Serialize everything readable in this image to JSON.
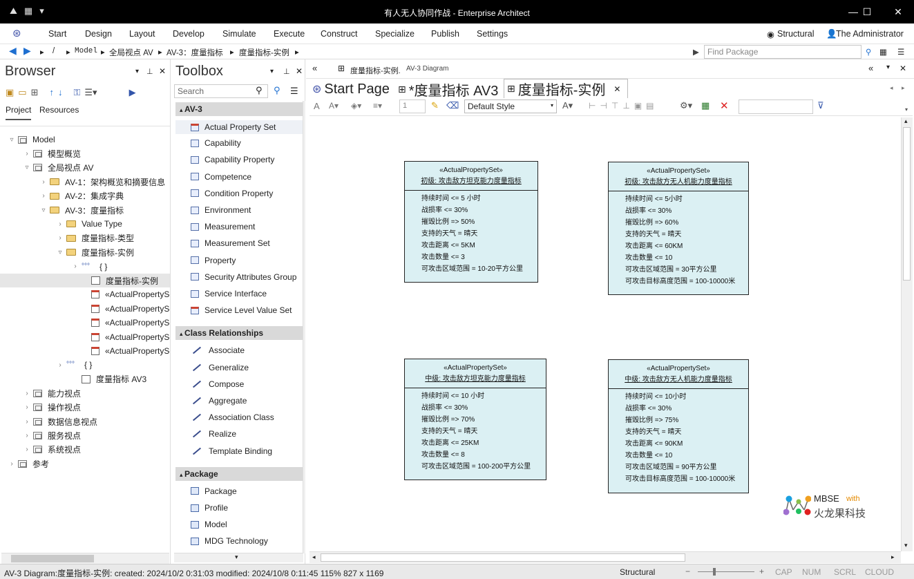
{
  "window": {
    "title": "有人无人协同作战 - Enterprise Architect"
  },
  "ribbon": {
    "menu": [
      "Start",
      "Design",
      "Layout",
      "Develop",
      "Simulate",
      "Execute",
      "Construct",
      "Specialize",
      "Publish",
      "Settings"
    ],
    "perspective": "Structural",
    "user": "The Administrator"
  },
  "nav": {
    "crumbs": [
      "/",
      "Model",
      "全局视点 AV",
      "AV-3：度量指标",
      "度量指标-实例"
    ],
    "find_placeholder": "Find Package"
  },
  "browser": {
    "title": "Browser",
    "tabs": [
      "Project",
      "Resources"
    ],
    "tree": [
      {
        "label": "Model",
        "indent": 0,
        "exp": "▿",
        "icon": "pkg"
      },
      {
        "label": "模型概览",
        "indent": 1,
        "exp": "›",
        "icon": "pkg"
      },
      {
        "label": "全局视点 AV",
        "indent": 1,
        "exp": "▿",
        "icon": "pkg"
      },
      {
        "label": "AV-1：架构概览和摘要信息",
        "indent": 2,
        "exp": "›",
        "icon": "folder"
      },
      {
        "label": "AV-2：集成字典",
        "indent": 2,
        "exp": "›",
        "icon": "folder"
      },
      {
        "label": "AV-3：度量指标",
        "indent": 2,
        "exp": "▿",
        "icon": "folder"
      },
      {
        "label": "Value Type",
        "indent": 3,
        "exp": "›",
        "icon": "folder"
      },
      {
        "label": "度量指标-类型",
        "indent": 3,
        "exp": "›",
        "icon": "folder"
      },
      {
        "label": "度量指标-实例",
        "indent": 3,
        "exp": "▿",
        "icon": "folder"
      },
      {
        "label": "{ }",
        "indent": 4,
        "exp": "›",
        "icon": "dots"
      },
      {
        "label": "度量指标-实例",
        "indent": 5,
        "exp": "",
        "icon": "diag"
      },
      {
        "label": "«ActualPropertySet",
        "indent": 5,
        "exp": "",
        "icon": "cls"
      },
      {
        "label": "«ActualPropertySet",
        "indent": 5,
        "exp": "",
        "icon": "cls"
      },
      {
        "label": "«ActualPropertySet",
        "indent": 5,
        "exp": "",
        "icon": "cls"
      },
      {
        "label": "«ActualPropertySet",
        "indent": 5,
        "exp": "",
        "icon": "cls"
      },
      {
        "label": "«ActualPropertySet",
        "indent": 5,
        "exp": "",
        "icon": "cls"
      },
      {
        "label": "{ }",
        "indent": 3,
        "exp": "›",
        "icon": "dots"
      },
      {
        "label": "度量指标 AV3",
        "indent": 4,
        "exp": "",
        "icon": "diag"
      },
      {
        "label": "能力视点",
        "indent": 1,
        "exp": "›!",
        "icon": "pkg"
      },
      {
        "label": "操作视点",
        "indent": 1,
        "exp": "›",
        "icon": "pkg"
      },
      {
        "label": "数据信息视点",
        "indent": 1,
        "exp": "›",
        "icon": "pkg"
      },
      {
        "label": "服务视点",
        "indent": 1,
        "exp": "›",
        "icon": "pkg"
      },
      {
        "label": "系统视点",
        "indent": 1,
        "exp": "›",
        "icon": "pkg"
      },
      {
        "label": "参考",
        "indent": 0,
        "exp": "›",
        "icon": "pkg"
      }
    ]
  },
  "toolbox": {
    "title": "Toolbox",
    "search_placeholder": "Search",
    "sections": [
      {
        "name": "AV-3",
        "items": [
          "Actual Property Set",
          "Capability",
          "Capability Property",
          "Competence",
          "Condition Property",
          "Environment",
          "Measurement",
          "Measurement Set",
          "Property",
          "Security Attributes Group",
          "Service Interface",
          "Service Level Value Set"
        ]
      },
      {
        "name": "Class Relationships",
        "items": [
          "Associate",
          "Generalize",
          "Compose",
          "Aggregate",
          "Association Class",
          "Realize",
          "Template Binding"
        ]
      },
      {
        "name": "Package",
        "items": [
          "Package",
          "Profile",
          "Model",
          "MDG Technology"
        ]
      }
    ]
  },
  "doc": {
    "header_label": "度量指标-实例.",
    "header_sub": "AV-3 Diagram",
    "tabs": [
      "Start Page",
      "*度量指标 AV3",
      "度量指标-实例"
    ],
    "style_select": "Default Style",
    "zoom_field": "1"
  },
  "diagram": {
    "elements": [
      {
        "stereotype": "«ActualPropertySet»",
        "name": "初级: 攻击敌方坦克能力度量指标",
        "attrs": [
          "持续时间 <= 5 小时",
          "战损率 <= 30%",
          "摧毁比例 => 50%",
          "支持的天气 = 晴天",
          "攻击距离 <= 5KM",
          "攻击数量 <= 3",
          "可攻击区域范围 = 10-20平方公里"
        ]
      },
      {
        "stereotype": "«ActualPropertySet»",
        "name": "初级: 攻击敌方无人机能力度量指标",
        "attrs": [
          "持续时间 <= 5小时",
          "战损率 <= 30%",
          "摧毁比例 => 60%",
          "支持的天气 = 晴天",
          "攻击距离 <= 60KM",
          "攻击数量 <= 10",
          "可攻击区域范围 = 30平方公里",
          "可攻击目标高度范围 = 100-10000米"
        ]
      },
      {
        "stereotype": "«ActualPropertySet»",
        "name": "中级: 攻击敌方坦克能力度量指标",
        "attrs": [
          "持续时间 <= 10 小时",
          "战损率 <= 30%",
          "摧毁比例 => 70%",
          "支持的天气 = 晴天",
          "攻击距离 <= 25KM",
          "攻击数量 <= 8",
          "可攻击区域范围 = 100-200平方公里"
        ]
      },
      {
        "stereotype": "«ActualPropertySet»",
        "name": "中级: 攻击敌方无人机能力度量指标",
        "attrs": [
          "持续时间 <= 10小时",
          "战损率 <= 30%",
          "摧毁比例 => 75%",
          "支持的天气 = 晴天",
          "攻击距离 <= 90KM",
          "攻击数量 <= 10",
          "可攻击区域范围 = 90平方公里",
          "可攻击目标高度范围 = 100-10000米"
        ]
      }
    ],
    "watermark": {
      "brand": "MBSE",
      "with": "with",
      "company": "火龙果科技"
    }
  },
  "status": {
    "text": "AV-3 Diagram:度量指标-实例:   created: 2024/10/2 0:31:03   modified: 2024/10/8 0:11:45   115%   827 x 1169",
    "perspective": "Structural",
    "indicators": [
      "CAP",
      "NUM",
      "SCRL",
      "CLOUD"
    ]
  },
  "colors": {
    "element_fill": "#dbf0f3",
    "section_bg": "#d9d9d9",
    "titlebar": "#000000",
    "accent": "#1e6fd0"
  }
}
